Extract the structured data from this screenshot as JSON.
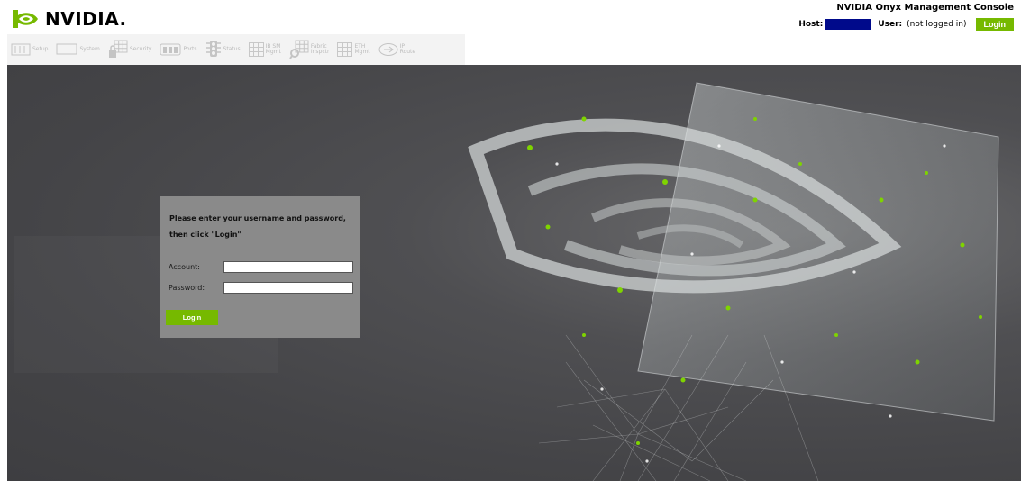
{
  "brand": {
    "name": "NVIDIA.",
    "color": "#76b900"
  },
  "header": {
    "app_title": "NVIDIA Onyx Management Console",
    "host_label": "Host:",
    "user_label": "User:",
    "user_value": "(not logged in)",
    "login_label": "Login"
  },
  "nav": {
    "items": [
      {
        "label": "Setup",
        "icon": "setup-icon"
      },
      {
        "label": "System",
        "icon": "system-icon"
      },
      {
        "label": "Security",
        "icon": "lock-icon"
      },
      {
        "label": "Ports",
        "icon": "ports-icon"
      },
      {
        "label": "Status",
        "icon": "status-icon"
      },
      {
        "label": "IB SM\nMgmt",
        "icon": "ib-sm-icon"
      },
      {
        "label": "Fabric\nInspctr",
        "icon": "fabric-inspector-icon"
      },
      {
        "label": "ETH\nMgmt",
        "icon": "eth-mgmt-icon"
      },
      {
        "label": "IP\nRoute",
        "icon": "ip-route-icon"
      }
    ]
  },
  "login": {
    "message_line1": "Please enter your username and password,",
    "message_line2": "then click \"Login\"",
    "account_label": "Account:",
    "account_value": "",
    "password_label": "Password:",
    "password_value": "",
    "button_label": "Login"
  }
}
